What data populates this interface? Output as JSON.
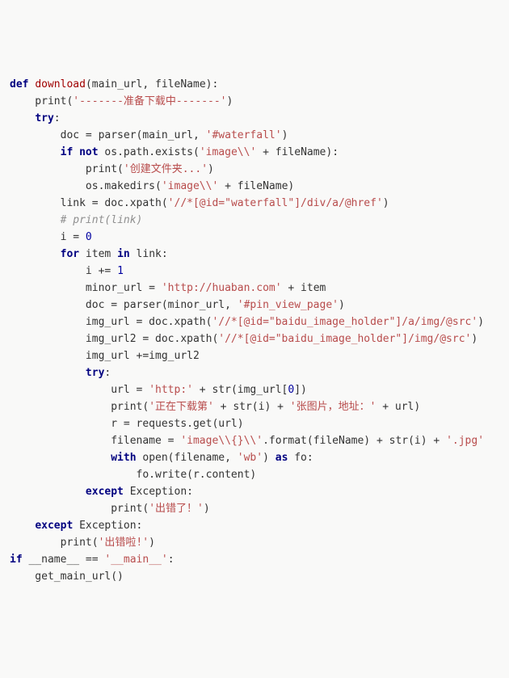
{
  "code": {
    "lines": [
      {
        "segs": [
          {
            "cls": "kw",
            "t": "def "
          },
          {
            "cls": "fn",
            "t": "download"
          },
          {
            "cls": "id",
            "t": "(main_url, fileName):"
          }
        ]
      },
      {
        "segs": [
          {
            "cls": "id",
            "t": "    print("
          },
          {
            "cls": "str",
            "t": "'-------准备下载中-------'"
          },
          {
            "cls": "id",
            "t": ")"
          }
        ]
      },
      {
        "segs": [
          {
            "cls": "id",
            "t": "    "
          },
          {
            "cls": "kw",
            "t": "try"
          },
          {
            "cls": "id",
            "t": ":"
          }
        ]
      },
      {
        "segs": [
          {
            "cls": "id",
            "t": "        doc = parser(main_url, "
          },
          {
            "cls": "str",
            "t": "'#waterfall'"
          },
          {
            "cls": "id",
            "t": ")"
          }
        ]
      },
      {
        "segs": [
          {
            "cls": "id",
            "t": "        "
          },
          {
            "cls": "kw",
            "t": "if not"
          },
          {
            "cls": "id",
            "t": " os.path.exists("
          },
          {
            "cls": "str",
            "t": "'image\\\\'"
          },
          {
            "cls": "id",
            "t": " + fileName):"
          }
        ]
      },
      {
        "segs": [
          {
            "cls": "id",
            "t": "            print("
          },
          {
            "cls": "str",
            "t": "'创建文件夹...'"
          },
          {
            "cls": "id",
            "t": ")"
          }
        ]
      },
      {
        "segs": [
          {
            "cls": "id",
            "t": "            os.makedirs("
          },
          {
            "cls": "str",
            "t": "'image\\\\'"
          },
          {
            "cls": "id",
            "t": " + fileName)"
          }
        ]
      },
      {
        "segs": [
          {
            "cls": "id",
            "t": "        link = doc.xpath("
          },
          {
            "cls": "str",
            "t": "'//*[@id=\"waterfall\"]/div/a/@href'"
          },
          {
            "cls": "id",
            "t": ")"
          }
        ]
      },
      {
        "segs": [
          {
            "cls": "id",
            "t": "        "
          },
          {
            "cls": "cmt",
            "t": "# print(link)"
          }
        ]
      },
      {
        "segs": [
          {
            "cls": "id",
            "t": "        i = "
          },
          {
            "cls": "num",
            "t": "0"
          }
        ]
      },
      {
        "segs": [
          {
            "cls": "id",
            "t": "        "
          },
          {
            "cls": "kw",
            "t": "for"
          },
          {
            "cls": "id",
            "t": " item "
          },
          {
            "cls": "kw",
            "t": "in"
          },
          {
            "cls": "id",
            "t": " link:"
          }
        ]
      },
      {
        "segs": [
          {
            "cls": "id",
            "t": "            i += "
          },
          {
            "cls": "num",
            "t": "1"
          }
        ]
      },
      {
        "segs": [
          {
            "cls": "id",
            "t": "            minor_url = "
          },
          {
            "cls": "str",
            "t": "'http://huaban.com'"
          },
          {
            "cls": "id",
            "t": " + item"
          }
        ]
      },
      {
        "segs": [
          {
            "cls": "id",
            "t": "            doc = parser(minor_url, "
          },
          {
            "cls": "str",
            "t": "'#pin_view_page'"
          },
          {
            "cls": "id",
            "t": ")"
          }
        ]
      },
      {
        "segs": [
          {
            "cls": "id",
            "t": "            img_url = doc.xpath("
          },
          {
            "cls": "str",
            "t": "'//*[@id=\"baidu_image_holder\"]/a/img/@src'"
          },
          {
            "cls": "id",
            "t": ")"
          }
        ]
      },
      {
        "segs": [
          {
            "cls": "id",
            "t": "            img_url2 = doc.xpath("
          },
          {
            "cls": "str",
            "t": "'//*[@id=\"baidu_image_holder\"]/img/@src'"
          },
          {
            "cls": "id",
            "t": ")"
          }
        ]
      },
      {
        "segs": [
          {
            "cls": "id",
            "t": "            img_url +=img_url2"
          }
        ]
      },
      {
        "segs": [
          {
            "cls": "id",
            "t": "            "
          },
          {
            "cls": "kw",
            "t": "try"
          },
          {
            "cls": "id",
            "t": ":"
          }
        ]
      },
      {
        "segs": [
          {
            "cls": "id",
            "t": "                url = "
          },
          {
            "cls": "str",
            "t": "'http:'"
          },
          {
            "cls": "id",
            "t": " + str(img_url["
          },
          {
            "cls": "num",
            "t": "0"
          },
          {
            "cls": "id",
            "t": "])"
          }
        ]
      },
      {
        "segs": [
          {
            "cls": "id",
            "t": "                print("
          },
          {
            "cls": "str",
            "t": "'正在下载第'"
          },
          {
            "cls": "id",
            "t": " + str(i) + "
          },
          {
            "cls": "str",
            "t": "'张图片，地址：'"
          },
          {
            "cls": "id",
            "t": " + url)"
          }
        ]
      },
      {
        "segs": [
          {
            "cls": "id",
            "t": "                r = requests.get(url)"
          }
        ]
      },
      {
        "segs": [
          {
            "cls": "id",
            "t": "                filename = "
          },
          {
            "cls": "str",
            "t": "'image\\\\{}\\\\'"
          },
          {
            "cls": "id",
            "t": ".format(fileName) + str(i) + "
          },
          {
            "cls": "str",
            "t": "'.jpg'"
          }
        ]
      },
      {
        "segs": [
          {
            "cls": "id",
            "t": "                "
          },
          {
            "cls": "kw",
            "t": "with"
          },
          {
            "cls": "id",
            "t": " open(filename, "
          },
          {
            "cls": "str",
            "t": "'wb'"
          },
          {
            "cls": "id",
            "t": ") "
          },
          {
            "cls": "kw",
            "t": "as"
          },
          {
            "cls": "id",
            "t": " fo:"
          }
        ]
      },
      {
        "segs": [
          {
            "cls": "id",
            "t": "                    fo.write(r.content)"
          }
        ]
      },
      {
        "segs": [
          {
            "cls": "id",
            "t": "            "
          },
          {
            "cls": "kw",
            "t": "except"
          },
          {
            "cls": "id",
            "t": " Exception:"
          }
        ]
      },
      {
        "segs": [
          {
            "cls": "id",
            "t": "                print("
          },
          {
            "cls": "str",
            "t": "'出错了！'"
          },
          {
            "cls": "id",
            "t": ")"
          }
        ]
      },
      {
        "segs": [
          {
            "cls": "id",
            "t": "    "
          },
          {
            "cls": "kw",
            "t": "except"
          },
          {
            "cls": "id",
            "t": " Exception:"
          }
        ]
      },
      {
        "segs": [
          {
            "cls": "id",
            "t": "        print("
          },
          {
            "cls": "str",
            "t": "'出错啦!'"
          },
          {
            "cls": "id",
            "t": ")"
          }
        ]
      },
      {
        "segs": [
          {
            "cls": "id",
            "t": ""
          }
        ]
      },
      {
        "segs": [
          {
            "cls": "id",
            "t": ""
          }
        ]
      },
      {
        "segs": [
          {
            "cls": "kw",
            "t": "if"
          },
          {
            "cls": "id",
            "t": " __name__ == "
          },
          {
            "cls": "str",
            "t": "'__main__'"
          },
          {
            "cls": "id",
            "t": ":"
          }
        ]
      },
      {
        "segs": [
          {
            "cls": "id",
            "t": "    get_main_url()"
          }
        ]
      }
    ]
  }
}
